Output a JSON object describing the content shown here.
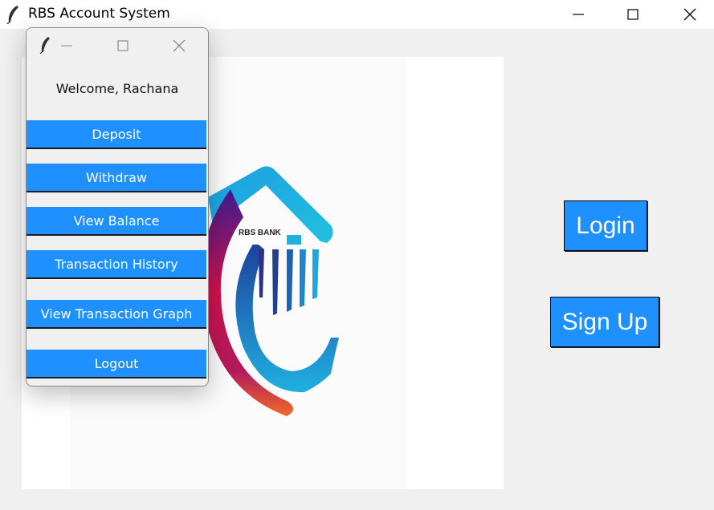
{
  "window": {
    "title": "RBS Account System",
    "icon": "feather-icon"
  },
  "logo": {
    "text": "RBS BANK"
  },
  "auth": {
    "login_label": "Login",
    "signup_label": "Sign Up"
  },
  "popup": {
    "icon": "feather-icon",
    "welcome": "Welcome, Rachana",
    "buttons": [
      {
        "label": "Deposit"
      },
      {
        "label": "Withdraw"
      },
      {
        "label": "View Balance"
      },
      {
        "label": "Transaction History"
      },
      {
        "label": "View Transaction Graph"
      },
      {
        "label": "Logout"
      }
    ]
  },
  "colors": {
    "button_blue": "#1e90ff",
    "background": "#f0f0f0"
  }
}
